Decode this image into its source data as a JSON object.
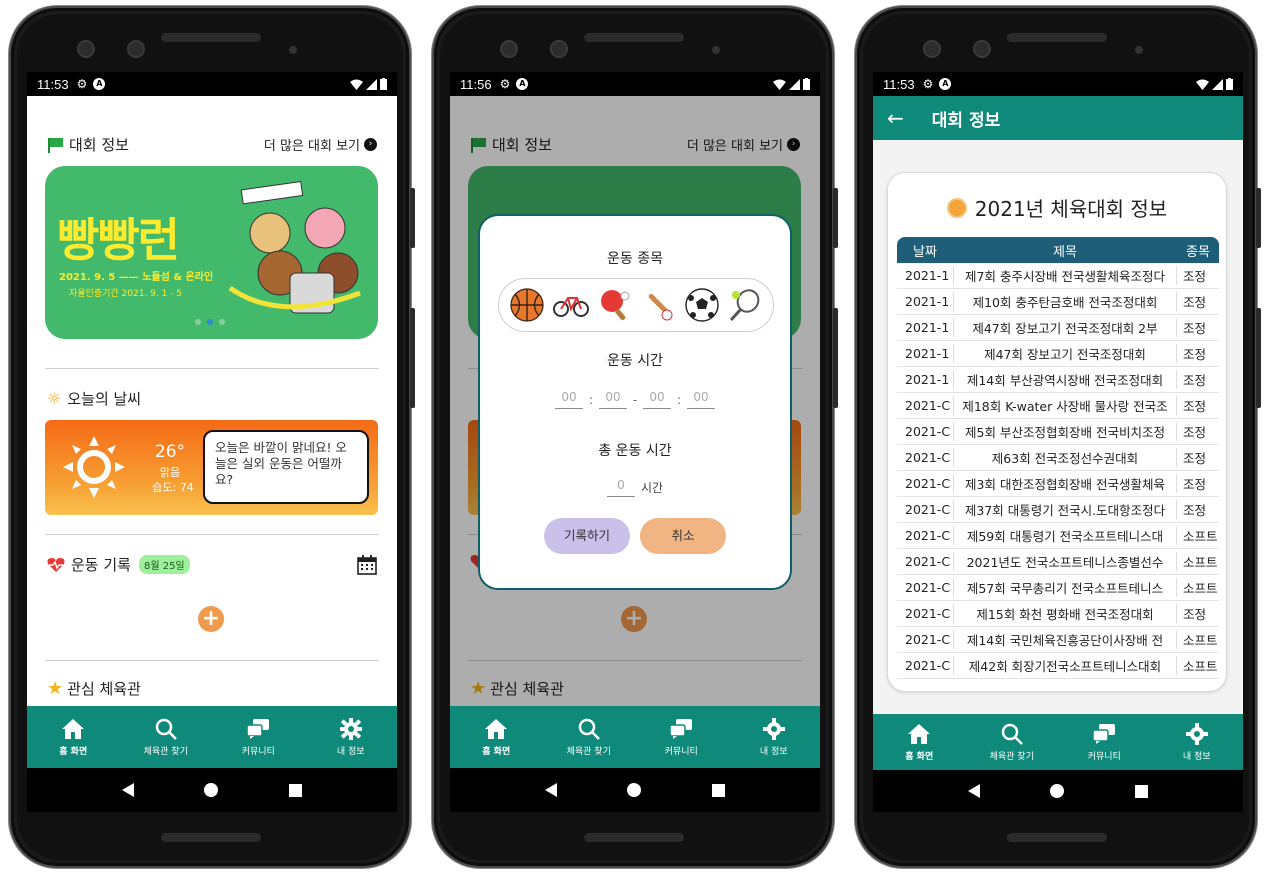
{
  "status": [
    {
      "time": "11:53"
    },
    {
      "time": "11:56"
    },
    {
      "time": "11:53"
    }
  ],
  "home": {
    "competition_section": "대회 정보",
    "more_competitions": "더 많은 대회 보기",
    "banner": {
      "title": "빵빵런",
      "date": "2021. 9. 5 —— 노들섬 & 온라인",
      "sub": "자율인증기간  2021. 9. 1 - 5",
      "slides": 3,
      "active_slide": 2
    },
    "weather_section": "오늘의 날씨",
    "weather": {
      "temp": "26°",
      "condition": "맑음",
      "humidity": "습도: 74",
      "message": "오늘은 바깥이 맑네요! 오늘은 실외 운동은 어떨까요?"
    },
    "exercise_section": "운동 기록",
    "exercise_date": "8월 25일",
    "favorites_section": "관심 체육관"
  },
  "nav": {
    "home": "홈 화면",
    "find_gym": "체육관 찾기",
    "community": "커뮤니티",
    "my_info": "내 정보"
  },
  "dialog": {
    "sport_label": "운동 종목",
    "time_label": "운동 시간",
    "time_placeholders": [
      "00",
      "00",
      "00",
      "00"
    ],
    "total_label": "총 운동 시간",
    "total_placeholder": "0",
    "total_unit": "시간",
    "record_btn": "기록하기",
    "cancel_btn": "취소",
    "sports": [
      "basketball-icon",
      "bicycle-icon",
      "ping-pong-icon",
      "baseball-icon",
      "soccer-icon",
      "tennis-icon"
    ]
  },
  "competitions": {
    "appbar_title": "대회 정보",
    "card_title": "2021년 체육대회 정보",
    "columns": [
      "날짜",
      "제목",
      "종목"
    ],
    "rows": [
      {
        "date": "2021-1",
        "title": "제7회 충주시장배 전국생활체육조정다",
        "type": "조정"
      },
      {
        "date": "2021-1",
        "title": "제10회 충주탄금호배 전국조정대회",
        "type": "조정"
      },
      {
        "date": "2021-1",
        "title": "제47회 장보고기 전국조정대회 2부",
        "type": "조정"
      },
      {
        "date": "2021-1",
        "title": "제47회 장보고기 전국조정대회",
        "type": "조정"
      },
      {
        "date": "2021-1",
        "title": "제14회 부산광역시장배 전국조정대회",
        "type": "조정"
      },
      {
        "date": "2021-C",
        "title": "제18회 K-water 사장배 물사랑 전국조",
        "type": "조정"
      },
      {
        "date": "2021-C",
        "title": "제5회 부산조정협회장배 전국비치조정",
        "type": "조정"
      },
      {
        "date": "2021-C",
        "title": "제63회 전국조정선수권대회",
        "type": "조정"
      },
      {
        "date": "2021-C",
        "title": "제3회 대한조정협회장배 전국생활체육",
        "type": "조정"
      },
      {
        "date": "2021-C",
        "title": "제37회 대통령기 전국시.도대항조정다",
        "type": "조정"
      },
      {
        "date": "2021-C",
        "title": "제59회 대통령기 전국소프트테니스대",
        "type": "소프트"
      },
      {
        "date": "2021-C",
        "title": "2021년도 전국소프트테니스종별선수",
        "type": "소프트"
      },
      {
        "date": "2021-C",
        "title": "제57회 국무총리기 전국소프트테니스",
        "type": "소프트"
      },
      {
        "date": "2021-C",
        "title": "제15회 화천 평화배 전국조정대회",
        "type": "조정"
      },
      {
        "date": "2021-C",
        "title": "제14회 국민체육진흥공단이사장배 전",
        "type": "소프트"
      },
      {
        "date": "2021-C",
        "title": "제42회 회장기전국소프트테니스대회",
        "type": "소프트"
      }
    ]
  },
  "colors": {
    "teal": "#0f8a7a",
    "table_header": "#1e5e78",
    "banner_green": "#43b96b",
    "banner_yellow": "#fdeb2f",
    "orange": "#f09a4e",
    "record_btn": "#c9c1ea",
    "cancel_btn": "#f1b584"
  }
}
